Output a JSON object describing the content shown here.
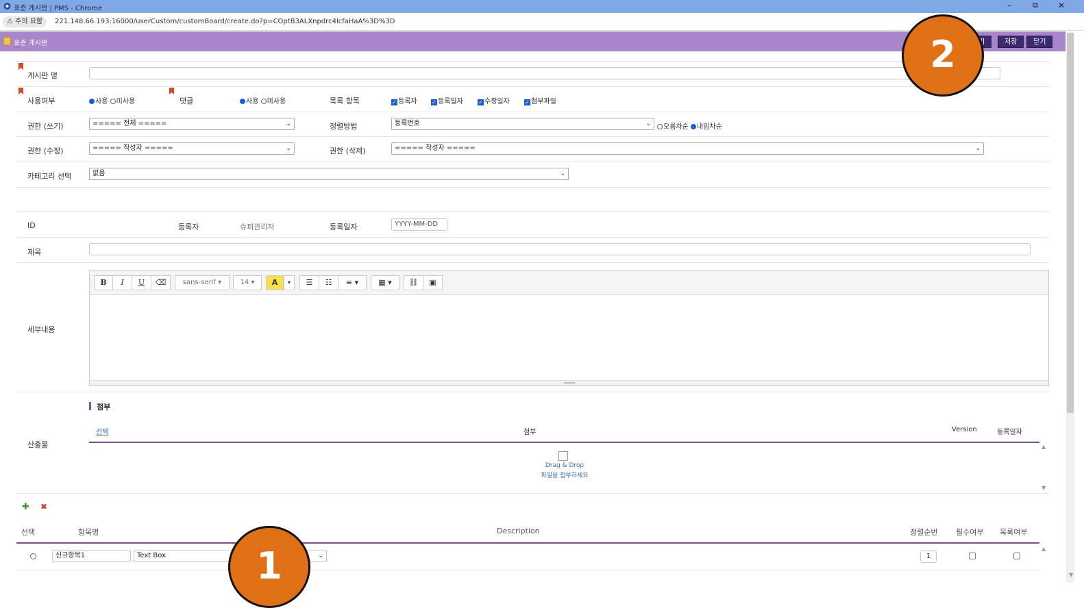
{
  "window": {
    "title": "표준 게시판 | PMS - Chrome",
    "minimize": "–",
    "restore": "⧉",
    "close": "✕"
  },
  "address": {
    "warning": "⚠ 주의 요함",
    "url": "221.148.66.193:16000/userCustom/customBoard/create.do?p=COptB3ALXnpdrc4lcfaHaA%3D%3D"
  },
  "appbar": {
    "title": "표준 게시판",
    "buttons": [
      "기",
      "저장",
      "닫기"
    ]
  },
  "form": {
    "board_name_label": "게시판 명",
    "use_label": "사용여부",
    "use_opt1": "사용",
    "use_opt2": "미사용",
    "comment_label": "댓글",
    "comment_opt1": "사용",
    "comment_opt2": "미사용",
    "list_items_label": "목록 항목",
    "list_items": [
      "등록자",
      "등록일자",
      "수정일자",
      "첨부파일"
    ],
    "perm_write_label": "권한 (쓰기)",
    "perm_write_value": "===== 전체 =====",
    "sort_label": "정렬방법",
    "sort_value": "등록번호",
    "sort_asc": "오름차순",
    "sort_desc": "내림차순",
    "perm_edit_label": "권한 (수정)",
    "perm_edit_value": "===== 작성자 =====",
    "perm_delete_label": "권한 (삭제)",
    "perm_delete_value": "===== 작성자 =====",
    "category_label": "카테고리 선택",
    "category_value": "없음",
    "id_label": "ID",
    "author_label": "등록자",
    "author_value": "슈퍼관리자",
    "date_label": "등록일자",
    "date_placeholder": "YYYY-MM-DD",
    "title_label": "제목",
    "content_label": "세부내용",
    "editor": {
      "bold": "B",
      "italic": "I",
      "underline": "U",
      "eraser": "⌫",
      "font": "sans-serif",
      "size": "14",
      "color": "A",
      "ul": "☰",
      "ol": "☷",
      "align": "≡",
      "table": "▦",
      "link": "⛓",
      "image": "▣"
    },
    "attach_section": "첨부",
    "output_label": "산출물",
    "attach_cols": {
      "select": "선택",
      "attach": "첨부",
      "version": "Version",
      "date": "등록일자"
    },
    "drop_line1": "Drag & Drop",
    "drop_line2": "파일을 첨부하세요"
  },
  "items": {
    "add": "✚",
    "del": "✖",
    "headers": {
      "select": "선택",
      "name": "항목명",
      "description": "Description",
      "order": "정렬순번",
      "required": "필수여부",
      "listed": "목록여부"
    },
    "rows": [
      {
        "name": "신규항목1",
        "type": "Text Box",
        "order": "1"
      }
    ]
  },
  "markers": {
    "m1": "1",
    "m2": "2"
  }
}
